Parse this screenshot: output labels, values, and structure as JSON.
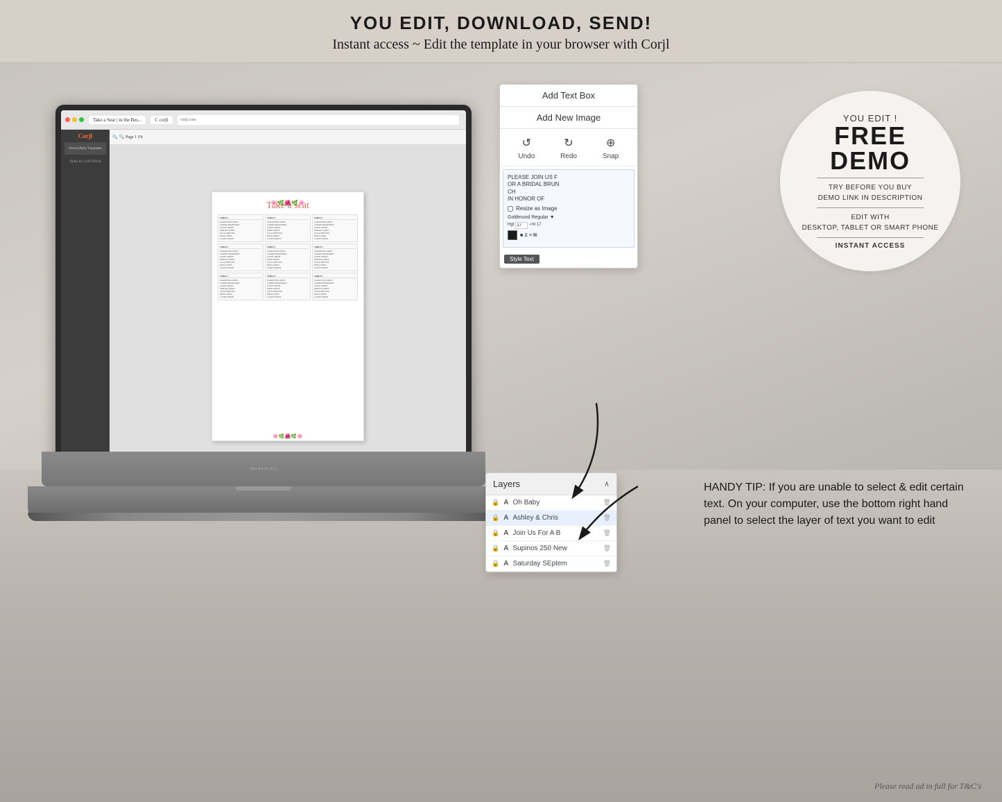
{
  "page": {
    "dimensions": "1445x1155"
  },
  "top_banner": {
    "line1": "YOU EDIT, DOWNLOAD, SEND!",
    "line2": "Instant access ~ Edit the template in your browser with Corjl"
  },
  "corjl_editor": {
    "logo": "Corjl",
    "nav_items": [
      "NoorayParty Templates"
    ],
    "toolbar": {
      "order_id": "Order Id: 1509758194",
      "tools": [
        "Zoom In",
        "Zoom Out",
        "Page",
        "Fit"
      ]
    },
    "browser": {
      "tab1": "Take a Seat | in the Bes...",
      "address": "corjl.com",
      "tab2": "C corjl"
    }
  },
  "side_panel": {
    "add_text_box_label": "Add Text Box",
    "add_new_image_label": "Add New Image",
    "undo_label": "Undo",
    "redo_label": "Redo",
    "snap_label": "Snap",
    "resize_label": "Resize as Image",
    "font_name": "Goldmund Regular",
    "style_text_label": "Style Text"
  },
  "layers_panel": {
    "header": "Layers",
    "items": [
      {
        "name": "Oh Baby",
        "type": "A",
        "locked": true
      },
      {
        "name": "Ashley & Chris",
        "type": "A",
        "locked": true
      },
      {
        "name": "Join Us For A B",
        "type": "A",
        "locked": true
      },
      {
        "name": "Supinos 250 New",
        "type": "A",
        "locked": true
      },
      {
        "name": "Saturday SEptem",
        "type": "A",
        "locked": true
      }
    ]
  },
  "free_demo_circle": {
    "you_edit": "YOU EDIT !",
    "free": "FREE",
    "demo": "DEMO",
    "try_before": "TRY BEFORE YOU BUY",
    "demo_link": "DEMO LINK IN DESCRIPTION",
    "edit_with": "EDIT WITH",
    "devices": "DESKTOP, TABLET OR\nSMART PHONE",
    "instant_access": "INSTANT ACCESS"
  },
  "handy_tip": {
    "text": "HANDY TIP: If you are unable to select & edit certain text. On your computer, use the bottom right hand panel to select the layer of text you want to edit"
  },
  "footer": {
    "text": "Please read ad in full for T&C's"
  },
  "seating_chart": {
    "title": "Take a seat",
    "tables": [
      {
        "label": "TABLE 1",
        "names": [
          "SAMANTHA JONES",
          "CARRIE BRADSHAW",
          "JASON SMITH",
          "JORDAN JONES",
          "TALIA SHITTEN",
          "DENA JONES",
          "CASEN SMITH",
          "MICHAEL JONES"
        ]
      },
      {
        "label": "TABLE 2",
        "names": [
          "SAMANTHA JONES",
          "CARRIE BRADSHAW",
          "JASON SMITH",
          "JOHN SMITH",
          "TALIA SHITTEN",
          "DENA JONES",
          "CASEN SMITH",
          "MICHAEL JONES"
        ]
      },
      {
        "label": "TABLE 3",
        "names": [
          "SAMANTHA JONES",
          "CARRIE BRADSHAW",
          "JASON SMITH",
          "JORDAN JONES",
          "TALIA SHITTEN",
          "DENA JONES",
          "CASEN SMITH",
          "MICHAEL JONES"
        ]
      },
      {
        "label": "TABLE 4",
        "names": [
          "SAMANTHA JONES",
          "CARRIE BRADSHAW",
          "JASON SMITH",
          "JORDAN JONES",
          "TALIA SHITTEN",
          "DENA JONES",
          "CASEN SMITH",
          "MICHAEL JONES"
        ]
      },
      {
        "label": "TABLE 5",
        "names": [
          "SAMANTHA JONES",
          "CARRIE BRADSHAW",
          "JASON SMITH",
          "JOHN SMITH",
          "TALIA SHITTEN",
          "DENA JONES",
          "CASEN SMITH",
          "MICHAEL JONES"
        ]
      },
      {
        "label": "TABLE 6",
        "names": [
          "SAMANTHA JONES",
          "CARRIE BRADSHAW",
          "JASON SMITH",
          "JORDAN JONES",
          "TALIA SHITTEN",
          "DENA JONES",
          "CASEN SMITH",
          "MICHAEL JONES"
        ]
      },
      {
        "label": "TABLE 7",
        "names": [
          "SAMANTHA JONES",
          "CARRIE BRADSHAW",
          "JASON SMITH",
          "JORDAN JONES",
          "TALIA SHITTEN",
          "DENA JONES",
          "CASEN SMITH",
          "MICHAEL JONES"
        ]
      },
      {
        "label": "TABLE 8",
        "names": [
          "SAMANTHA JONES",
          "CARRIE BRADSHAW",
          "JASON SMITH",
          "JOHN SMITH",
          "TALIA SHITTEN",
          "DENA JONES",
          "CASEN SMITH",
          "MICHAEL JONES"
        ]
      },
      {
        "label": "TABLE 9",
        "names": [
          "SAMANTHA JONES",
          "CARRIE BRADSHAW",
          "JASON SMITH",
          "JORDAN JONES",
          "TALIA SHITTEN",
          "DENA JONES",
          "CASEN SMITH",
          "MICHAEL JONES"
        ]
      }
    ]
  },
  "colors": {
    "background": "#ddd8d0",
    "banner_bg": "#d6d0c9",
    "panel_bg": "#ffffff",
    "accent_red": "#e07060",
    "text_dark": "#1a1a1a",
    "layers_header_bg": "#f0f0f0",
    "layers_active": "#e8f0fe"
  }
}
